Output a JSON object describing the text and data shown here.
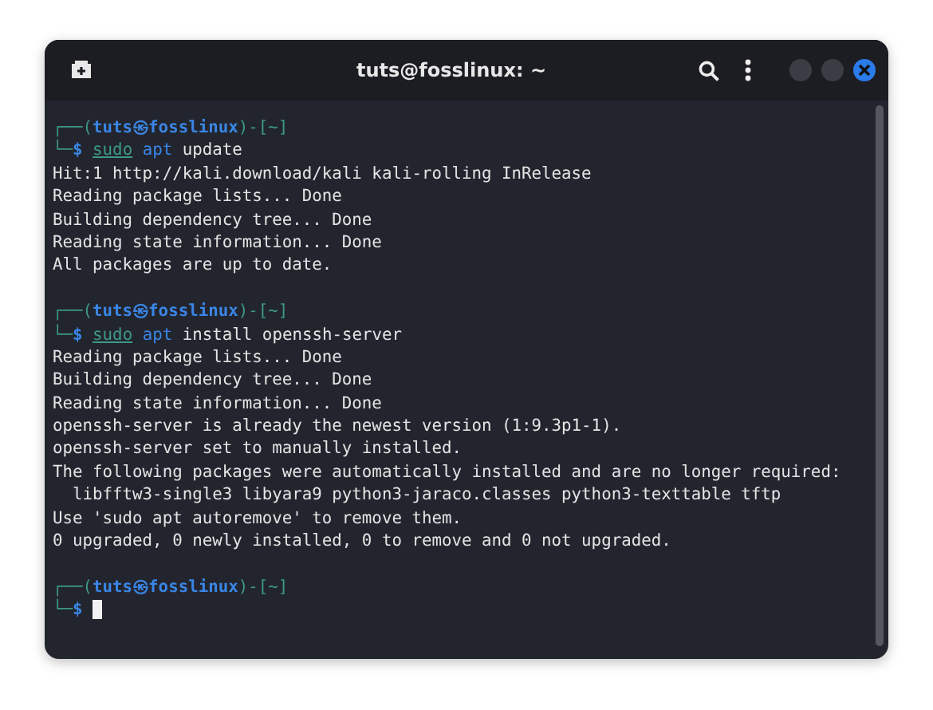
{
  "window": {
    "title": "tuts@fosslinux: ~"
  },
  "terminal": {
    "lines": [
      {
        "kind": "prompt",
        "segments": [
          {
            "kind": "frame",
            "text": "┌──("
          },
          {
            "kind": "user",
            "text": "tuts㉿fosslinux"
          },
          {
            "kind": "frame",
            "text": ")-["
          },
          {
            "kind": "dir",
            "text": "~"
          },
          {
            "kind": "frame",
            "text": "]"
          }
        ]
      },
      {
        "kind": "command",
        "segments": [
          {
            "kind": "frame",
            "text": "└─"
          },
          {
            "kind": "user",
            "text": "$"
          },
          {
            "kind": "sudo",
            "text": "sudo"
          },
          {
            "kind": "word",
            "text": "apt"
          },
          {
            "kind": "arg",
            "text": "update"
          }
        ]
      },
      {
        "kind": "output",
        "text": "Hit:1 http://kali.download/kali kali-rolling InRelease"
      },
      {
        "kind": "output",
        "text": "Reading package lists... Done"
      },
      {
        "kind": "output",
        "text": "Building dependency tree... Done"
      },
      {
        "kind": "output",
        "text": "Reading state information... Done"
      },
      {
        "kind": "output",
        "text": "All packages are up to date."
      },
      {
        "kind": "blank"
      },
      {
        "kind": "prompt",
        "segments": [
          {
            "kind": "frame",
            "text": "┌──("
          },
          {
            "kind": "user",
            "text": "tuts㉿fosslinux"
          },
          {
            "kind": "frame",
            "text": ")-["
          },
          {
            "kind": "dir",
            "text": "~"
          },
          {
            "kind": "frame",
            "text": "]"
          }
        ]
      },
      {
        "kind": "command",
        "segments": [
          {
            "kind": "frame",
            "text": "└─"
          },
          {
            "kind": "user",
            "text": "$"
          },
          {
            "kind": "sudo",
            "text": "sudo"
          },
          {
            "kind": "word",
            "text": "apt"
          },
          {
            "kind": "arg",
            "text": "install openssh-server"
          }
        ]
      },
      {
        "kind": "output",
        "text": "Reading package lists... Done"
      },
      {
        "kind": "output",
        "text": "Building dependency tree... Done"
      },
      {
        "kind": "output",
        "text": "Reading state information... Done"
      },
      {
        "kind": "output",
        "text": "openssh-server is already the newest version (1:9.3p1-1)."
      },
      {
        "kind": "output",
        "text": "openssh-server set to manually installed."
      },
      {
        "kind": "output",
        "text": "The following packages were automatically installed and are no longer required:"
      },
      {
        "kind": "output",
        "text": "  libfftw3-single3 libyara9 python3-jaraco.classes python3-texttable tftp"
      },
      {
        "kind": "output",
        "text": "Use 'sudo apt autoremove' to remove them."
      },
      {
        "kind": "output",
        "text": "0 upgraded, 0 newly installed, 0 to remove and 0 not upgraded."
      },
      {
        "kind": "blank"
      },
      {
        "kind": "prompt",
        "segments": [
          {
            "kind": "frame",
            "text": "┌──("
          },
          {
            "kind": "user",
            "text": "tuts㉿fosslinux"
          },
          {
            "kind": "frame",
            "text": ")-["
          },
          {
            "kind": "dir",
            "text": "~"
          },
          {
            "kind": "frame",
            "text": "]"
          }
        ]
      },
      {
        "kind": "input",
        "segments": [
          {
            "kind": "frame",
            "text": "└─"
          },
          {
            "kind": "user",
            "text": "$"
          }
        ]
      }
    ]
  }
}
